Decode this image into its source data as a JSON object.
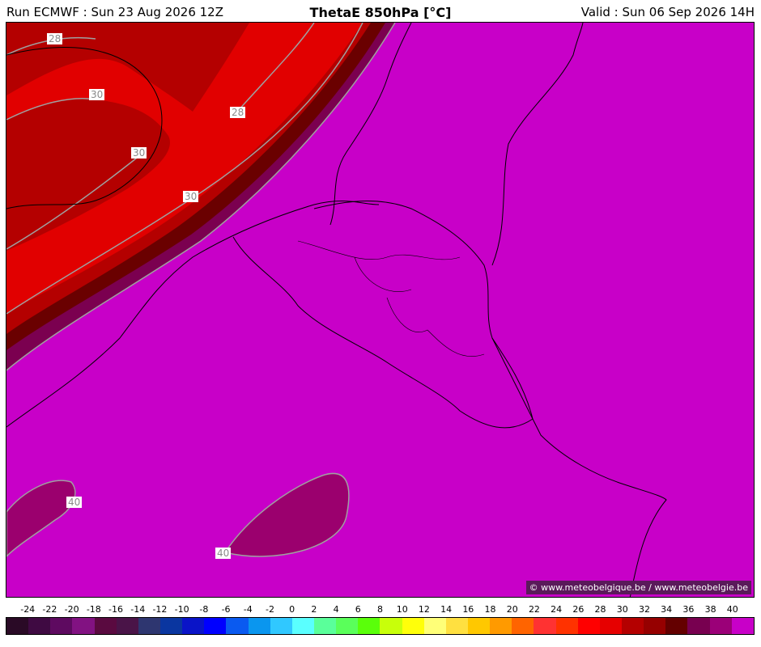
{
  "header": {
    "run": "Run ECMWF : Sun 23 Aug 2026 12Z",
    "title": "ThetaE 850hPa [°C]",
    "valid": "Valid : Sun 06 Sep 2026 14H"
  },
  "map": {
    "contour_labels": [
      "28",
      "30",
      "28",
      "30",
      "30",
      "40",
      "40"
    ],
    "copyright": "© www.meteobelgique.be / www.meteobelgie.be",
    "colors": {
      "base": "#c800c8",
      "c36": "#7b0050",
      "c34": "#6a0000",
      "c32": "#b40000",
      "c30": "#b40000",
      "c28": "#e10000",
      "c38": "#9b006e"
    }
  },
  "legend": {
    "ticks": [
      "-24",
      "-22",
      "-20",
      "-18",
      "-16",
      "-14",
      "-12",
      "-10",
      "-8",
      "-6",
      "-4",
      "-2",
      "0",
      "2",
      "4",
      "6",
      "8",
      "10",
      "12",
      "14",
      "16",
      "18",
      "20",
      "22",
      "24",
      "26",
      "28",
      "30",
      "32",
      "34",
      "36",
      "38",
      "40"
    ],
    "colors": [
      "#2a0a26",
      "#3f0a42",
      "#5e0a60",
      "#821282",
      "#5a0a40",
      "#4a1448",
      "#2e3670",
      "#0a36a0",
      "#0a14c8",
      "#0000ff",
      "#0a5af0",
      "#0a96ef",
      "#30c8ff",
      "#5affff",
      "#5aff9a",
      "#5aff5a",
      "#5aff0a",
      "#c8ff0a",
      "#ffff0a",
      "#ffff78",
      "#ffe040",
      "#ffc800",
      "#ff9a00",
      "#ff6400",
      "#ff3232",
      "#ff3200",
      "#ff0000",
      "#e60000",
      "#b40000",
      "#960000",
      "#640000",
      "#780050",
      "#9b0078",
      "#c800c8"
    ]
  }
}
